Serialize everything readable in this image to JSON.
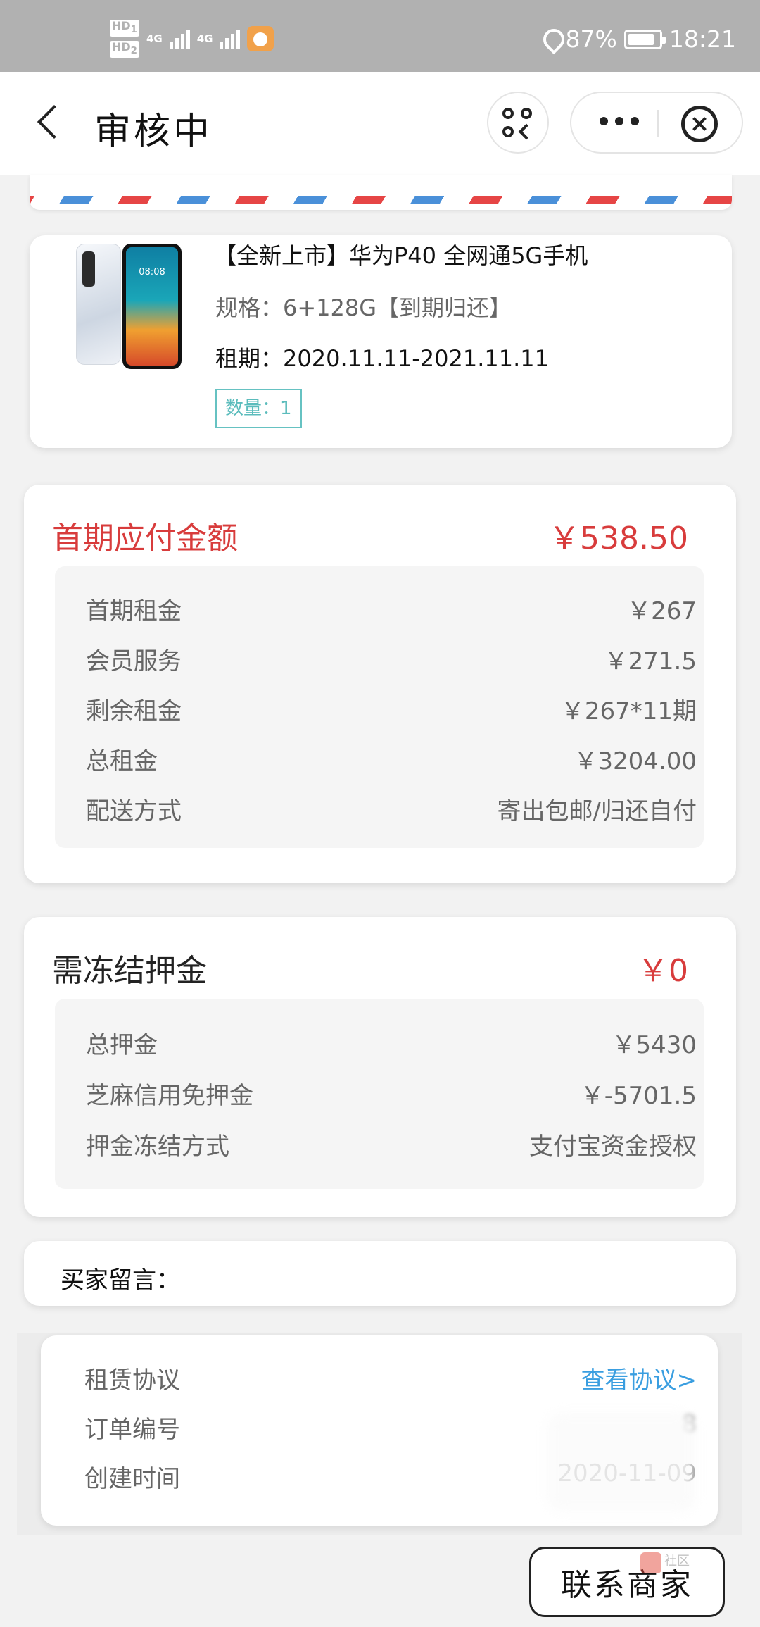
{
  "status_bar": {
    "hd1": "HD",
    "hd1_sub": "1",
    "hd2": "HD",
    "hd2_sub": "2",
    "sim1": "4G",
    "sim2": "4G",
    "battery": "87%",
    "time": "18:21",
    "battery_level": 0.87
  },
  "nav": {
    "title": "审核中"
  },
  "product": {
    "title": "【全新上市】华为P40 全网通5G手机",
    "spec": "规格：6+128G【到期归还】",
    "term": "租期：2020.11.11-2021.11.11",
    "quantity": "数量：1",
    "screen_time": "08:08"
  },
  "payment": {
    "heading": "首期应付金额",
    "amount": "￥538.50",
    "rows": [
      {
        "label": "首期租金",
        "value": "￥267"
      },
      {
        "label": "会员服务",
        "value": "￥271.5"
      },
      {
        "label": "剩余租金",
        "value": "￥267*11期"
      },
      {
        "label": "总租金",
        "value": "￥3204.00"
      },
      {
        "label": "配送方式",
        "value": "寄出包邮/归还自付"
      }
    ]
  },
  "deposit": {
    "heading": "需冻结押金",
    "amount": "￥0",
    "rows": [
      {
        "label": "总押金",
        "value": "￥5430"
      },
      {
        "label": "芝麻信用免押金",
        "value": "￥-5701.5"
      },
      {
        "label": "押金冻结方式",
        "value": "支付宝资金授权"
      }
    ]
  },
  "message": {
    "label": "买家留言："
  },
  "info": {
    "agreement_label": "租赁协议",
    "agreement_link": "查看协议>",
    "order_no_label": "订单编号",
    "order_no_value": "8",
    "created_label": "创建时间",
    "created_value": "2020-11-09 "
  },
  "footer": {
    "contact_button": "联系商家",
    "watermark": "社区"
  },
  "colors": {
    "accent_red": "#d83c3c",
    "link_blue": "#3a9ee0",
    "qty_teal": "#5bbcbc"
  }
}
